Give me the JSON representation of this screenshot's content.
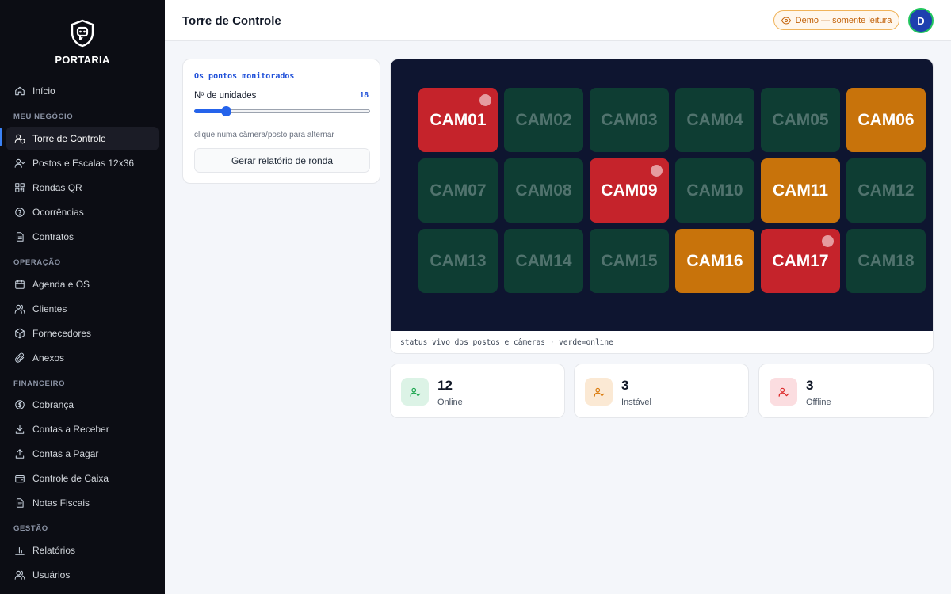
{
  "brand": {
    "name": "PORTARIA",
    "logo_icon": "shield-icon"
  },
  "sidebar": {
    "top_item": {
      "label": "Início",
      "icon": "home-icon"
    },
    "sections": [
      {
        "title": "MEU NEGÓCIO",
        "items": [
          {
            "label": "Torre de Controle",
            "icon": "user-shield-icon",
            "active": true
          },
          {
            "label": "Postos e Escalas 12x36",
            "icon": "users-icon"
          },
          {
            "label": "Rondas QR",
            "icon": "qr-icon"
          },
          {
            "label": "Ocorrências",
            "icon": "help-circle-icon"
          },
          {
            "label": "Contratos",
            "icon": "document-icon"
          }
        ]
      },
      {
        "title": "OPERAÇÃO",
        "items": [
          {
            "label": "Agenda e OS",
            "icon": "calendar-icon"
          },
          {
            "label": "Clientes",
            "icon": "people-icon"
          },
          {
            "label": "Fornecedores",
            "icon": "package-icon"
          },
          {
            "label": "Anexos",
            "icon": "paperclip-icon"
          }
        ]
      },
      {
        "title": "FINANCEIRO",
        "items": [
          {
            "label": "Cobrança",
            "icon": "dollar-icon"
          },
          {
            "label": "Contas a Receber",
            "icon": "download-icon"
          },
          {
            "label": "Contas a Pagar",
            "icon": "upload-icon"
          },
          {
            "label": "Controle de Caixa",
            "icon": "wallet-icon"
          },
          {
            "label": "Notas Fiscais",
            "icon": "receipt-icon"
          }
        ]
      },
      {
        "title": "GESTÃO",
        "items": [
          {
            "label": "Relatórios",
            "icon": "bar-chart-icon"
          },
          {
            "label": "Usuários",
            "icon": "people-icon"
          }
        ]
      }
    ]
  },
  "header": {
    "title": "Torre de Controle",
    "demo_badge": "Demo — somente leitura",
    "avatar_initial": "D"
  },
  "controls": {
    "title": "Os pontos monitorados",
    "units_label": "Nº de unidades",
    "units_value": 18,
    "units_value_text": "18",
    "units_max": 100,
    "hint": "clique numa câmera/posto para alternar",
    "report_button": "Gerar relatório de ronda"
  },
  "cameras": {
    "items": [
      {
        "label": "CAM01",
        "status": "offline"
      },
      {
        "label": "CAM02",
        "status": "online"
      },
      {
        "label": "CAM03",
        "status": "online"
      },
      {
        "label": "CAM04",
        "status": "online"
      },
      {
        "label": "CAM05",
        "status": "online"
      },
      {
        "label": "CAM06",
        "status": "unstable"
      },
      {
        "label": "CAM07",
        "status": "online"
      },
      {
        "label": "CAM08",
        "status": "online"
      },
      {
        "label": "CAM09",
        "status": "offline"
      },
      {
        "label": "CAM10",
        "status": "online"
      },
      {
        "label": "CAM11",
        "status": "unstable"
      },
      {
        "label": "CAM12",
        "status": "online"
      },
      {
        "label": "CAM13",
        "status": "online"
      },
      {
        "label": "CAM14",
        "status": "online"
      },
      {
        "label": "CAM15",
        "status": "online"
      },
      {
        "label": "CAM16",
        "status": "unstable"
      },
      {
        "label": "CAM17",
        "status": "offline"
      },
      {
        "label": "CAM18",
        "status": "online"
      }
    ],
    "caption": "status vivo dos postos e câmeras · verde=online"
  },
  "stats": [
    {
      "value": "12",
      "label": "Online",
      "color": "#16a34a",
      "bg": "#dcf3e6"
    },
    {
      "value": "3",
      "label": "Instável",
      "color": "#d97706",
      "bg": "#fbe9d4"
    },
    {
      "value": "3",
      "label": "Offline",
      "color": "#dc2626",
      "bg": "#fbdde0"
    }
  ],
  "colors": {
    "online": "#0e3d33",
    "unstable": "#c8730b",
    "offline": "#c5232b",
    "accent": "#2563eb"
  }
}
